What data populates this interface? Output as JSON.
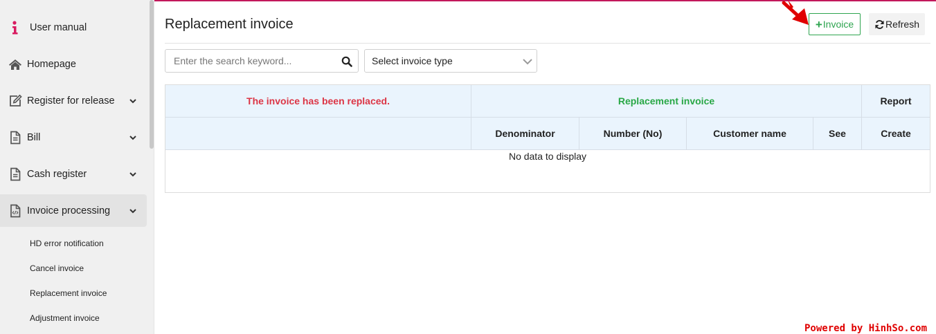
{
  "sidebar": {
    "items": [
      {
        "label": "User manual",
        "icon": "info-icon"
      },
      {
        "label": "Homepage",
        "icon": "home-icon"
      },
      {
        "label": "Register for release",
        "icon": "edit-icon",
        "expandable": true
      },
      {
        "label": "Bill",
        "icon": "document-icon",
        "expandable": true
      },
      {
        "label": "Cash register",
        "icon": "document-icon",
        "expandable": true
      },
      {
        "label": "Invoice processing",
        "icon": "code-file-icon",
        "expandable": true,
        "active": true
      }
    ],
    "subitems": [
      {
        "label": "HD error notification"
      },
      {
        "label": "Cancel invoice"
      },
      {
        "label": "Replacement invoice"
      },
      {
        "label": "Adjustment invoice"
      }
    ]
  },
  "header": {
    "title": "Replacement invoice",
    "add_button_label": "Invoice",
    "refresh_button_label": "Refresh"
  },
  "filters": {
    "search_placeholder": "Enter the search keyword...",
    "search_value": "",
    "invoice_type_selected": "Select invoice type"
  },
  "table": {
    "group_headers": {
      "replaced": "The invoice has been replaced.",
      "replacement": "Replacement invoice",
      "report": "Report"
    },
    "columns": {
      "denominator": "Denominator",
      "number": "Number (No)",
      "customer_name": "Customer name",
      "see": "See",
      "create": "Create"
    },
    "empty_message": "No data to display"
  },
  "colors": {
    "accent_line": "#c2185b",
    "add_button": "#2ea44f",
    "replaced_header": "#dc3545",
    "replacement_header": "#28a745",
    "table_header_bg": "#eaf4fd",
    "arrow": "#e00000"
  },
  "watermark": "Powered by HinhSo.com"
}
